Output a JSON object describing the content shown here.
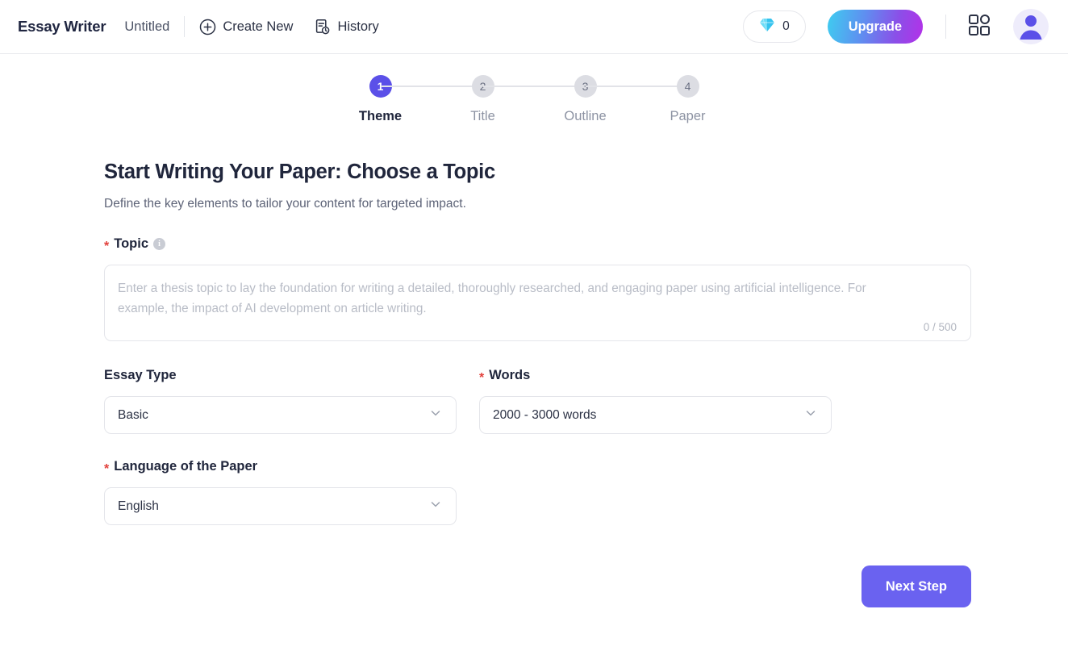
{
  "header": {
    "brand": "Essay Writer",
    "doc_title": "Untitled",
    "create_new_label": "Create New",
    "create_new_icon": "plus-circle-icon",
    "history_label": "History",
    "history_icon": "document-clock-icon",
    "credits": {
      "icon": "diamond-gem-icon",
      "count": "0"
    },
    "upgrade_label": "Upgrade",
    "apps_icon": "apps-grid-icon",
    "avatar_icon": "user-avatar-icon",
    "colors": {
      "upgrade_gradient_start": "#3ecdf0",
      "upgrade_gradient_end": "#b430e8",
      "accent_purple": "#6a62f0",
      "gem_blue": "#35c3ee"
    }
  },
  "stepper": {
    "steps": [
      {
        "number": "1",
        "label": "Theme",
        "active": true
      },
      {
        "number": "2",
        "label": "Title",
        "active": false
      },
      {
        "number": "3",
        "label": "Outline",
        "active": false
      },
      {
        "number": "4",
        "label": "Paper",
        "active": false
      }
    ]
  },
  "main": {
    "title": "Start Writing Your Paper: Choose a Topic",
    "subtitle": "Define the key elements to tailor your content for targeted impact.",
    "topic": {
      "required_mark": "*",
      "label": "Topic",
      "info_icon": "info-icon",
      "info_glyph": "i",
      "placeholder": "Enter a thesis topic to lay the foundation for writing a detailed, thoroughly researched, and engaging paper using artificial intelligence. For example, the impact of AI development on article writing.",
      "value": "",
      "char_counter": "0 / 500",
      "max_length": "500"
    },
    "essay_type": {
      "label": "Essay Type",
      "required": false,
      "value": "Basic",
      "chevron_icon": "chevron-down-icon"
    },
    "words": {
      "required_mark": "*",
      "label": "Words",
      "required": true,
      "value": "2000 - 3000 words",
      "chevron_icon": "chevron-down-icon"
    },
    "language": {
      "required_mark": "*",
      "label": "Language of the Paper",
      "required": true,
      "value": "English",
      "chevron_icon": "chevron-down-icon"
    },
    "next_step_label": "Next Step"
  }
}
